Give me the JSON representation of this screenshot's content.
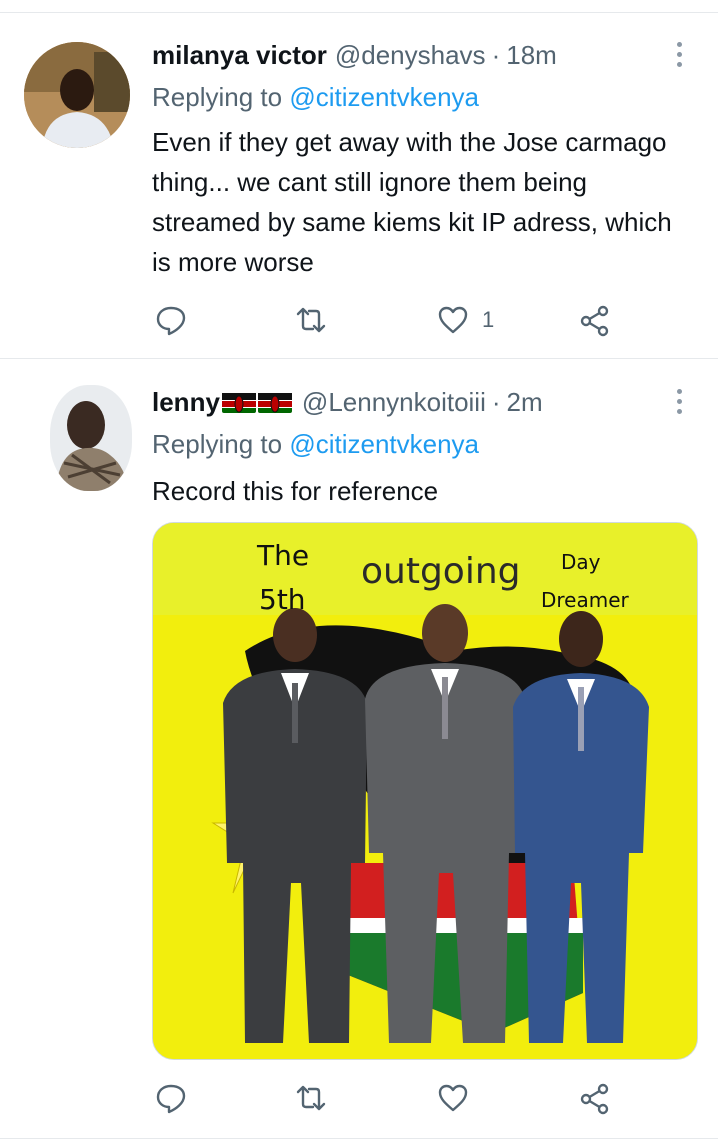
{
  "tweets": [
    {
      "name": "milanya victor",
      "handle": "@denyshavs",
      "separator": "·",
      "time": "18m",
      "replying_prefix": "Replying to",
      "replying_to": "@citizentvkenya",
      "text": "Even if they get away with the Jose carmago thing... we cant still ignore them being streamed by same kiems kit IP adress, which is more worse",
      "likes": "1"
    },
    {
      "name": "lenny",
      "handle": "@Lennynkoitoiii",
      "separator": "·",
      "time": "2m",
      "replying_prefix": "Replying to",
      "replying_to": "@citizentvkenya",
      "text": "Record this for reference",
      "likes": "",
      "image": {
        "text_the": "The",
        "text_5th": "5th",
        "text_outgoing": "outgoing",
        "text_day": "Day",
        "text_dreamer": "Dreamer"
      }
    }
  ],
  "colors": {
    "link": "#1d9bf0",
    "secondary_text": "#536471",
    "image_background": "#f2ee0d"
  },
  "icons": [
    "more-vertical-icon",
    "reply-icon",
    "retweet-icon",
    "like-icon",
    "share-icon",
    "kenya-flag-icon"
  ]
}
